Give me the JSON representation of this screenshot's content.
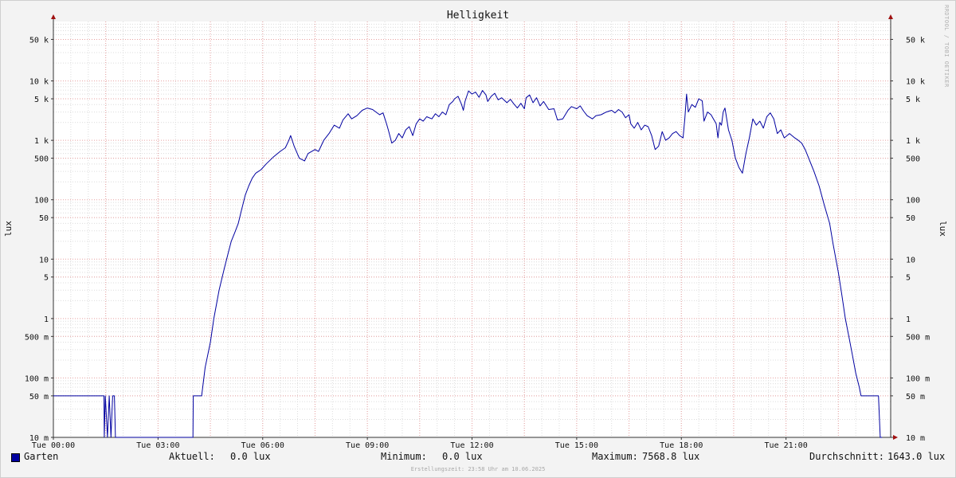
{
  "chart_data": {
    "type": "line",
    "title": "Helligkeit",
    "ylabel": "lux",
    "yscale": "log",
    "ylim": [
      0.01,
      100000
    ],
    "xlim_hours": [
      0,
      24
    ],
    "grid": true,
    "x_ticks": [
      {
        "hour": 0,
        "label": "Tue 00:00"
      },
      {
        "hour": 3,
        "label": "Tue 03:00"
      },
      {
        "hour": 6,
        "label": "Tue 06:00"
      },
      {
        "hour": 9,
        "label": "Tue 09:00"
      },
      {
        "hour": 12,
        "label": "Tue 12:00"
      },
      {
        "hour": 15,
        "label": "Tue 15:00"
      },
      {
        "hour": 18,
        "label": "Tue 18:00"
      },
      {
        "hour": 21,
        "label": "Tue 21:00"
      }
    ],
    "y_ticks": [
      {
        "value": 0.01,
        "label": "10 m"
      },
      {
        "value": 0.05,
        "label": "50 m"
      },
      {
        "value": 0.1,
        "label": "100 m"
      },
      {
        "value": 0.5,
        "label": "500 m"
      },
      {
        "value": 1,
        "label": "1"
      },
      {
        "value": 5,
        "label": "5"
      },
      {
        "value": 10,
        "label": "10"
      },
      {
        "value": 50,
        "label": "50"
      },
      {
        "value": 100,
        "label": "100"
      },
      {
        "value": 500,
        "label": "500"
      },
      {
        "value": 1000,
        "label": "1 k"
      },
      {
        "value": 5000,
        "label": "5 k"
      },
      {
        "value": 10000,
        "label": "10 k"
      },
      {
        "value": 50000,
        "label": "50 k"
      }
    ],
    "series": [
      {
        "name": "Garten",
        "color": "#0000a0",
        "points": [
          [
            0.0,
            0.05
          ],
          [
            1.45,
            0.05
          ],
          [
            1.46,
            0.01
          ],
          [
            1.49,
            0.05
          ],
          [
            1.55,
            0.01
          ],
          [
            1.6,
            0.05
          ],
          [
            1.65,
            0.01
          ],
          [
            1.7,
            0.05
          ],
          [
            1.75,
            0.05
          ],
          [
            1.78,
            0.01
          ],
          [
            4.0,
            0.01
          ],
          [
            4.01,
            0.05
          ],
          [
            4.25,
            0.05
          ],
          [
            4.35,
            0.15
          ],
          [
            4.5,
            0.4
          ],
          [
            4.6,
            1.0
          ],
          [
            4.75,
            3.0
          ],
          [
            4.9,
            7.0
          ],
          [
            5.0,
            12
          ],
          [
            5.1,
            20
          ],
          [
            5.2,
            28
          ],
          [
            5.3,
            40
          ],
          [
            5.4,
            70
          ],
          [
            5.5,
            120
          ],
          [
            5.6,
            170
          ],
          [
            5.7,
            230
          ],
          [
            5.8,
            280
          ],
          [
            5.95,
            320
          ],
          [
            6.1,
            400
          ],
          [
            6.3,
            520
          ],
          [
            6.5,
            650
          ],
          [
            6.65,
            750
          ],
          [
            6.75,
            1000
          ],
          [
            6.8,
            1200
          ],
          [
            6.9,
            800
          ],
          [
            7.05,
            500
          ],
          [
            7.2,
            450
          ],
          [
            7.3,
            600
          ],
          [
            7.5,
            700
          ],
          [
            7.6,
            650
          ],
          [
            7.75,
            1000
          ],
          [
            7.9,
            1300
          ],
          [
            8.05,
            1800
          ],
          [
            8.2,
            1600
          ],
          [
            8.3,
            2200
          ],
          [
            8.45,
            2800
          ],
          [
            8.55,
            2300
          ],
          [
            8.7,
            2600
          ],
          [
            8.85,
            3200
          ],
          [
            9.0,
            3500
          ],
          [
            9.15,
            3300
          ],
          [
            9.35,
            2700
          ],
          [
            9.45,
            2900
          ],
          [
            9.55,
            1900
          ],
          [
            9.6,
            1500
          ],
          [
            9.7,
            900
          ],
          [
            9.8,
            1000
          ],
          [
            9.9,
            1300
          ],
          [
            10.0,
            1100
          ],
          [
            10.1,
            1500
          ],
          [
            10.2,
            1700
          ],
          [
            10.3,
            1200
          ],
          [
            10.4,
            1900
          ],
          [
            10.5,
            2300
          ],
          [
            10.6,
            2100
          ],
          [
            10.7,
            2500
          ],
          [
            10.85,
            2300
          ],
          [
            10.95,
            2800
          ],
          [
            11.05,
            2500
          ],
          [
            11.15,
            3000
          ],
          [
            11.25,
            2700
          ],
          [
            11.35,
            4000
          ],
          [
            11.45,
            4500
          ],
          [
            11.5,
            5000
          ],
          [
            11.6,
            5500
          ],
          [
            11.7,
            4000
          ],
          [
            11.75,
            3200
          ],
          [
            11.8,
            4500
          ],
          [
            11.9,
            6800
          ],
          [
            12.0,
            6000
          ],
          [
            12.1,
            6500
          ],
          [
            12.2,
            5300
          ],
          [
            12.3,
            6900
          ],
          [
            12.4,
            5800
          ],
          [
            12.45,
            4500
          ],
          [
            12.55,
            5500
          ],
          [
            12.65,
            6200
          ],
          [
            12.75,
            4800
          ],
          [
            12.85,
            5200
          ],
          [
            13.0,
            4300
          ],
          [
            13.1,
            4900
          ],
          [
            13.2,
            4100
          ],
          [
            13.3,
            3500
          ],
          [
            13.4,
            4200
          ],
          [
            13.5,
            3400
          ],
          [
            13.55,
            5200
          ],
          [
            13.65,
            5800
          ],
          [
            13.75,
            4300
          ],
          [
            13.85,
            5200
          ],
          [
            13.95,
            3800
          ],
          [
            14.05,
            4500
          ],
          [
            14.2,
            3300
          ],
          [
            14.35,
            3400
          ],
          [
            14.45,
            2200
          ],
          [
            14.6,
            2300
          ],
          [
            14.75,
            3200
          ],
          [
            14.85,
            3700
          ],
          [
            15.0,
            3400
          ],
          [
            15.1,
            3800
          ],
          [
            15.2,
            3100
          ],
          [
            15.3,
            2600
          ],
          [
            15.45,
            2300
          ],
          [
            15.55,
            2600
          ],
          [
            15.7,
            2700
          ],
          [
            15.85,
            3000
          ],
          [
            16.0,
            3200
          ],
          [
            16.1,
            2900
          ],
          [
            16.2,
            3300
          ],
          [
            16.3,
            3000
          ],
          [
            16.4,
            2400
          ],
          [
            16.5,
            2700
          ],
          [
            16.55,
            1900
          ],
          [
            16.65,
            1600
          ],
          [
            16.75,
            2000
          ],
          [
            16.85,
            1500
          ],
          [
            16.95,
            1800
          ],
          [
            17.05,
            1700
          ],
          [
            17.15,
            1200
          ],
          [
            17.25,
            700
          ],
          [
            17.35,
            800
          ],
          [
            17.45,
            1400
          ],
          [
            17.55,
            1000
          ],
          [
            17.65,
            1100
          ],
          [
            17.75,
            1300
          ],
          [
            17.85,
            1400
          ],
          [
            17.95,
            1200
          ],
          [
            18.05,
            1100
          ],
          [
            18.1,
            2300
          ],
          [
            18.15,
            6000
          ],
          [
            18.2,
            3000
          ],
          [
            18.3,
            4000
          ],
          [
            18.4,
            3600
          ],
          [
            18.5,
            5000
          ],
          [
            18.6,
            4600
          ],
          [
            18.65,
            2100
          ],
          [
            18.75,
            3000
          ],
          [
            18.85,
            2700
          ],
          [
            19.0,
            1900
          ],
          [
            19.05,
            1100
          ],
          [
            19.1,
            2000
          ],
          [
            19.15,
            1800
          ],
          [
            19.2,
            3000
          ],
          [
            19.25,
            3500
          ],
          [
            19.35,
            1500
          ],
          [
            19.45,
            1000
          ],
          [
            19.55,
            500
          ],
          [
            19.65,
            350
          ],
          [
            19.75,
            280
          ],
          [
            19.85,
            600
          ],
          [
            19.95,
            1100
          ],
          [
            20.05,
            2300
          ],
          [
            20.15,
            1800
          ],
          [
            20.25,
            2100
          ],
          [
            20.35,
            1600
          ],
          [
            20.45,
            2500
          ],
          [
            20.55,
            2900
          ],
          [
            20.65,
            2300
          ],
          [
            20.75,
            1300
          ],
          [
            20.85,
            1500
          ],
          [
            20.95,
            1100
          ],
          [
            21.1,
            1300
          ],
          [
            21.25,
            1100
          ],
          [
            21.35,
            1000
          ],
          [
            21.45,
            900
          ],
          [
            21.55,
            700
          ],
          [
            21.65,
            500
          ],
          [
            21.8,
            300
          ],
          [
            21.95,
            170
          ],
          [
            22.1,
            80
          ],
          [
            22.25,
            40
          ],
          [
            22.35,
            18
          ],
          [
            22.5,
            6
          ],
          [
            22.6,
            2.5
          ],
          [
            22.7,
            1.0
          ],
          [
            22.8,
            0.5
          ],
          [
            22.9,
            0.25
          ],
          [
            23.0,
            0.12
          ],
          [
            23.1,
            0.07
          ],
          [
            23.15,
            0.05
          ],
          [
            23.65,
            0.05
          ],
          [
            23.7,
            0.01
          ],
          [
            23.75,
            0.01
          ]
        ]
      }
    ]
  },
  "legend": {
    "series_name": "Garten",
    "current_label": "Aktuell:",
    "current_value": "0.0 lux",
    "min_label": "Minimum:",
    "min_value": "0.0 lux",
    "max_label": "Maximum:",
    "max_value": "7568.8 lux",
    "avg_label": "Durchschnitt:",
    "avg_value": "1643.0 lux"
  },
  "watermark": "RRDTOOL / TOBI OETIKER",
  "footer": "Erstellungszeit: 23:58 Uhr am 10.06.2025"
}
